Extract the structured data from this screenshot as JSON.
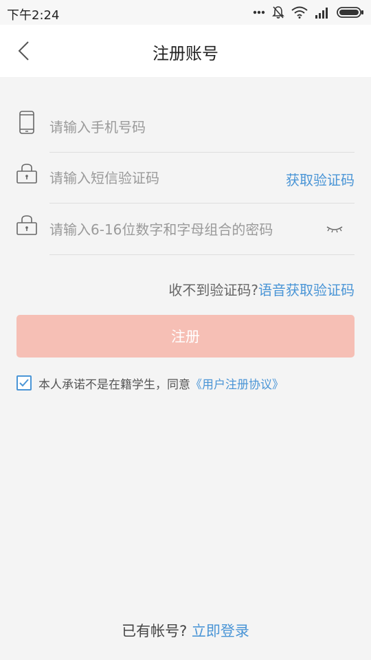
{
  "status_bar": {
    "time": "下午2:24"
  },
  "nav": {
    "back_icon": "chevron-left-icon",
    "title": "注册账号"
  },
  "form": {
    "phone": {
      "icon": "phone-icon",
      "placeholder": "请输入手机号码",
      "value": ""
    },
    "sms_code": {
      "icon": "lock-icon",
      "placeholder": "请输入短信验证码",
      "value": "",
      "get_code_label": "获取验证码"
    },
    "password": {
      "icon": "lock-icon",
      "placeholder": "请输入6-16位数字和字母组合的密码",
      "value": "",
      "toggle_icon": "eye-closed-icon"
    },
    "voice_prompt": "收不到验证码?",
    "voice_link": "语音获取验证码",
    "register_label": "注册"
  },
  "agreement": {
    "checked": true,
    "text": "本人承诺不是在籍学生，同意",
    "link": "《用户注册协议》"
  },
  "footer": {
    "prompt": "已有帐号?",
    "login_link": "立即登录"
  },
  "colors": {
    "accent": "#4a95d6",
    "register_button": "#f6bfb5",
    "background": "#f4f4f4"
  }
}
